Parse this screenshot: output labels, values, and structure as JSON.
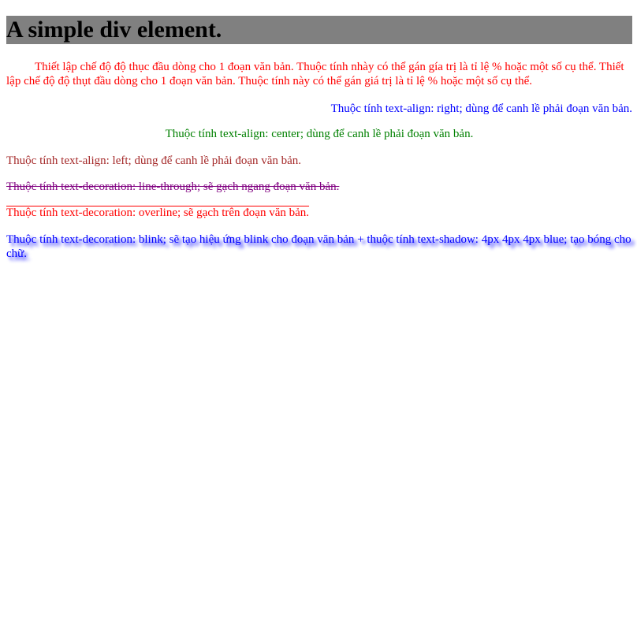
{
  "header": {
    "title": "A simple div element."
  },
  "paragraphs": {
    "indent": {
      "text": "Thiết lập chế độ độ thục đầu dòng cho 1 đoạn văn bản. Thuộc tính nhày có thể gán gía trị là tỉ lệ % hoặc một số cụ thể. Thiết lập chế độ độ thụt đầu dòng cho 1 đoạn văn bản. Thuộc tính này có thể gán giá trị là tỉ lệ % hoặc một số cụ thể.",
      "color": "#ff0000"
    },
    "right": {
      "text": "Thuộc tính text-align: right; dùng để canh lề phải đoạn văn bản.",
      "color": "#0000ff"
    },
    "center": {
      "text": "Thuộc tính text-align: center; dùng để canh lề phải đoạn văn bản.",
      "color": "#008000"
    },
    "left": {
      "text": "Thuộc tính text-align: left; dùng để canh lề phải đoạn văn bản.",
      "color": "#a52a2a"
    },
    "strike": {
      "text": "Thuộc tính text-decoration: line-through; sẽ gạch ngang đoạn văn bản.",
      "color": "#800080"
    },
    "overline": {
      "text": "Thuộc tính text-decoration: overline; sẽ gạch trên đoạn văn bản.",
      "color": "#ff0000"
    },
    "blink": {
      "text": "Thuộc tính text-decoration: blink; sẽ tạo hiệu ứng blink cho đoạn văn bản + thuộc tính text-shadow: 4px 4px 4px blue; tạo bóng cho chữ.",
      "color": "#0000ff",
      "shadow_color": "#0000ff"
    }
  },
  "colors": {
    "header_background": "#808080",
    "page_background": "#ffffff"
  }
}
